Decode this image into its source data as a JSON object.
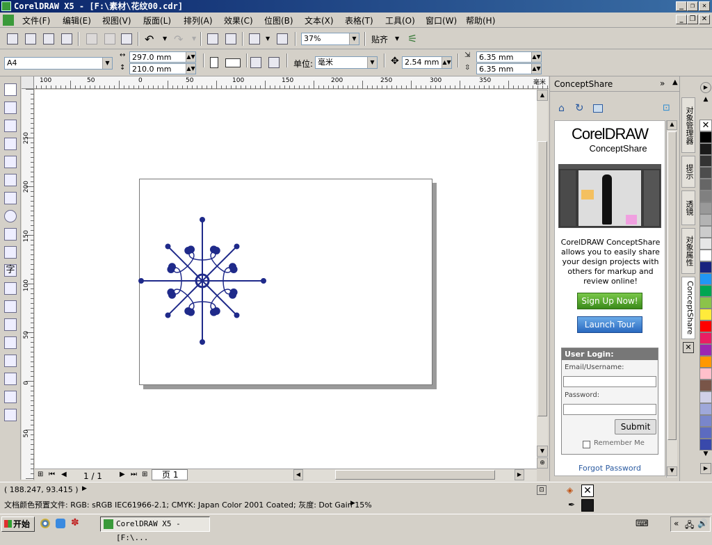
{
  "window": {
    "title": "CorelDRAW X5 - [F:\\素材\\花纹00.cdr]"
  },
  "menu": [
    "文件(F)",
    "编辑(E)",
    "视图(V)",
    "版面(L)",
    "排列(A)",
    "效果(C)",
    "位图(B)",
    "文本(X)",
    "表格(T)",
    "工具(O)",
    "窗口(W)",
    "帮助(H)"
  ],
  "toolbar": {
    "zoom": "37%",
    "snap_label": "贴齐"
  },
  "propbar": {
    "paper": "A4",
    "width": "297.0 mm",
    "height": "210.0 mm",
    "units_label": "单位:",
    "units": "毫米",
    "nudge": "2.54 mm",
    "dup_x": "6.35 mm",
    "dup_y": "6.35 mm"
  },
  "ruler": {
    "h_ticks": [
      "100",
      "50",
      "0",
      "50",
      "100",
      "150",
      "200",
      "250",
      "300",
      "350"
    ],
    "h_unit": "毫米",
    "v_ticks": [
      "250",
      "200",
      "150",
      "100",
      "50",
      "0",
      "50"
    ]
  },
  "page_nav": {
    "counter": "1 / 1",
    "tab": "页 1"
  },
  "panel": {
    "title": "ConceptShare",
    "logo_main": "CorelDRAW",
    "logo_sub": "ConceptShare",
    "description": "CorelDRAW ConceptShare allows you to easily share your design projects with others for markup and review online!",
    "signup": "Sign Up Now!",
    "launch": "Launch Tour",
    "login_title": "User Login:",
    "email_label": "Email/Username:",
    "password_label": "Password:",
    "submit": "Submit",
    "remember": "Remember Me",
    "forgot": "Forgot Password"
  },
  "vtabs": [
    "对象管理器",
    "提示",
    "透镜",
    "对象属性",
    "ConceptShare"
  ],
  "palette": [
    "#ffffff",
    "#000000",
    "#1a1a1a",
    "#333333",
    "#4d4d4d",
    "#666666",
    "#808080",
    "#999999",
    "#b3b3b3",
    "#cccccc",
    "#e6e6e6",
    "#ffffff",
    "#1a237e",
    "#2196f3",
    "#00a651",
    "#8bc34a",
    "#ffeb3b",
    "#ff0000",
    "#e91e63",
    "#9c27b0",
    "#ff9800",
    "#ffc0cb",
    "#795548",
    "#d0d0e8",
    "#9fa8da",
    "#7986cb",
    "#5c6bc0",
    "#3949ab"
  ],
  "status": {
    "coords": "( 188.247, 93.415 )",
    "profile": "文档颜色预置文件: RGB: sRGB IEC61966-2.1; CMYK: Japan Color 2001 Coated; 灰度: Dot Gain 15%"
  },
  "taskbar": {
    "start": "开始",
    "task": "CorelDRAW X5 - [F:\\..."
  },
  "colors": {
    "title_bg": "#0a246a",
    "ornament": "#1f2a8a"
  }
}
